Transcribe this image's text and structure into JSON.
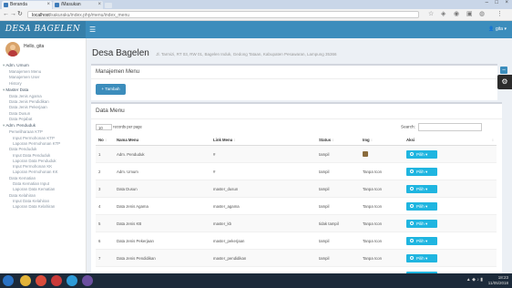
{
  "browser": {
    "tabs": [
      {
        "label": "Beranda"
      },
      {
        "label": "/Masukan"
      }
    ],
    "url_host": "localhost",
    "url_path": "/sakuraku/index.php/menu/index_menu"
  },
  "app": {
    "logo": "DESA BAGELEN",
    "user_menu": "gita"
  },
  "sidebar": {
    "user_name": "Hello, gita",
    "items": [
      {
        "label": "Adm. Umum",
        "level": 0
      },
      {
        "label": "Manajemen Menu",
        "level": 1
      },
      {
        "label": "Manajemen User",
        "level": 1
      },
      {
        "label": "History",
        "level": 1
      },
      {
        "label": "Master Data",
        "level": 0
      },
      {
        "label": "Data Jenis Agama",
        "level": 1
      },
      {
        "label": "Data Jenis Pendidikan",
        "level": 1
      },
      {
        "label": "Data Jenis Pekerjaan",
        "level": 1
      },
      {
        "label": "Data Dusun",
        "level": 1
      },
      {
        "label": "Data Pejabat",
        "level": 1
      },
      {
        "label": "Adm. Penduduk",
        "level": 0
      },
      {
        "label": "Pemeliharaan KTP",
        "level": 1
      },
      {
        "label": "Input Permohonan KTP",
        "level": 2
      },
      {
        "label": "Laporan Permohonan KTP",
        "level": 2
      },
      {
        "label": "Data Penduduk",
        "level": 1
      },
      {
        "label": "Input Data Penduduk",
        "level": 2
      },
      {
        "label": "Laporan Data Penduduk",
        "level": 2
      },
      {
        "label": "Input Permohonan KK",
        "level": 2
      },
      {
        "label": "Laporan Permohonan KK",
        "level": 2
      },
      {
        "label": "Data Kematian",
        "level": 1
      },
      {
        "label": "Data Kematian Input",
        "level": 2
      },
      {
        "label": "Laporan Data Kematian",
        "level": 2
      },
      {
        "label": "Data Kelahiran",
        "level": 1
      },
      {
        "label": "Input Data Kelahiran",
        "level": 2
      },
      {
        "label": "Laporan Data Kelahiran",
        "level": 2
      }
    ]
  },
  "page": {
    "title": "Desa Bagelen",
    "subtitle": "Jl. Tarmizi, RT 03, RW 01, Bagelen Induk, Gedong Tataan, Kabupaten Pesawaran, Lampung 35366"
  },
  "menu_box": {
    "title": "Manajemen Menu",
    "add_button": "+ Tambah",
    "collapse_icon": "minus"
  },
  "data_box": {
    "title": "Data Menu",
    "length_value": "10",
    "length_suffix": "records per page",
    "search_label": "Search:",
    "columns": [
      "No",
      "Nama Menu",
      "Link Menu",
      "Status",
      "Img",
      "Aksi"
    ],
    "action_label": "Pilih",
    "rows": [
      {
        "no": "1",
        "nama": "Adm. Penduduk",
        "link": "#",
        "status": "tampil",
        "img": "",
        "img_icon": true
      },
      {
        "no": "2",
        "nama": "Adm. Umum",
        "link": "#",
        "status": "tampil",
        "img": "Tanpa Icon",
        "img_icon": false
      },
      {
        "no": "3",
        "nama": "Data Dusun",
        "link": "master_dusun",
        "status": "tampil",
        "img": "Tanpa Icon",
        "img_icon": false
      },
      {
        "no": "4",
        "nama": "Data Jenis Agama",
        "link": "master_agama",
        "status": "tampil",
        "img": "Tanpa Icon",
        "img_icon": false
      },
      {
        "no": "5",
        "nama": "Data Jenis KB",
        "link": "master_kb",
        "status": "tidak tampil",
        "img": "Tanpa Icon",
        "img_icon": false
      },
      {
        "no": "6",
        "nama": "Data Jenis Pekerjaan",
        "link": "master_pekerjaan",
        "status": "tampil",
        "img": "Tanpa Icon",
        "img_icon": false
      },
      {
        "no": "7",
        "nama": "Data Jenis Pendidikan",
        "link": "master_pendidikan",
        "status": "tampil",
        "img": "Tanpa Icon",
        "img_icon": false
      },
      {
        "no": "8",
        "nama": "Data Kelahiran",
        "link": "#",
        "status": "tampil",
        "img": "Tanpa Icon",
        "img_icon": false
      }
    ]
  },
  "taskbar": {
    "time": "18:23",
    "date": "11/05/2018",
    "apps": [
      {
        "name": "explorer",
        "color": "#e2b33a"
      },
      {
        "name": "chrome",
        "color": "#d94b3b"
      },
      {
        "name": "opera",
        "color": "#c93a3a"
      },
      {
        "name": "edge",
        "color": "#2d9bd8"
      },
      {
        "name": "sublime",
        "color": "#6b4fa0"
      }
    ]
  }
}
